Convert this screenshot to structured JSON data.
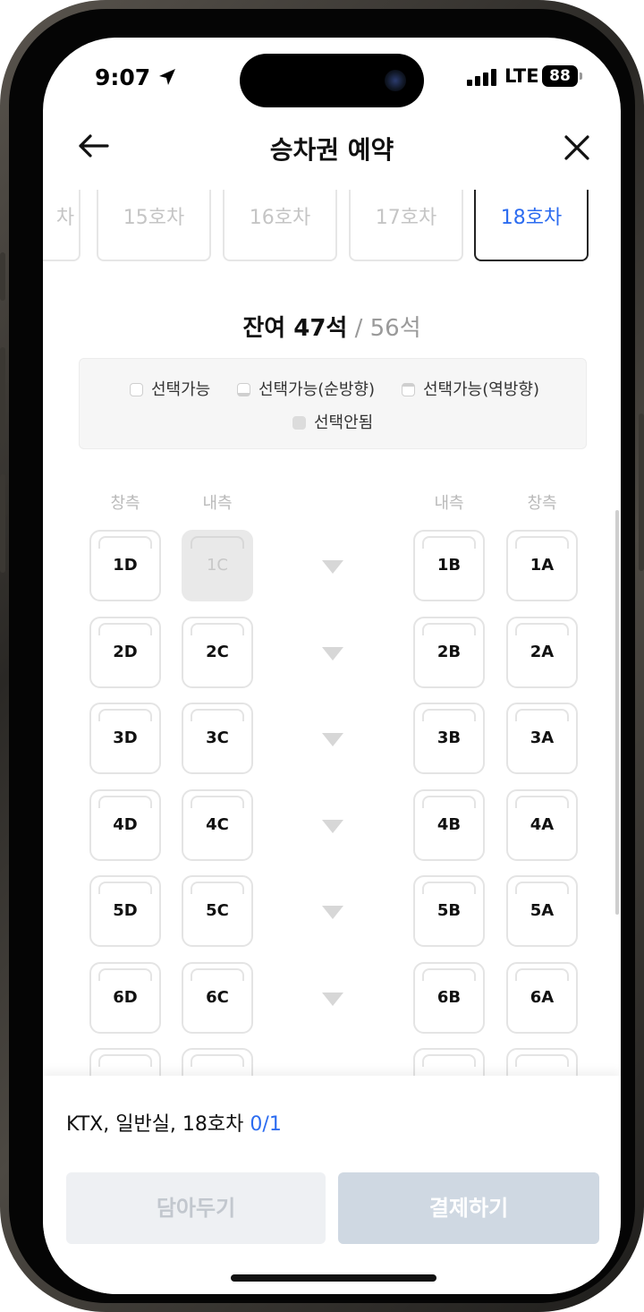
{
  "status": {
    "time": "9:07",
    "network": "LTE",
    "battery": "88",
    "location_icon": "location-arrow-icon",
    "signal_icon": "cellular-signal-icon"
  },
  "header": {
    "title": "승차권 예약",
    "back_icon": "arrow-left-icon",
    "close_icon": "close-icon"
  },
  "car_tabs": [
    {
      "label": "차",
      "active": false
    },
    {
      "label": "15호차",
      "active": false
    },
    {
      "label": "16호차",
      "active": false
    },
    {
      "label": "17호차",
      "active": false
    },
    {
      "label": "18호차",
      "active": true
    }
  ],
  "seat_summary": {
    "remaining": "잔여 47석",
    "separator": " / ",
    "total": "56석"
  },
  "legend": {
    "available": "선택가능",
    "forward": "선택가능(순방향)",
    "reverse": "선택가능(역방향)",
    "unavailable": "선택안됨"
  },
  "columns": {
    "window_left": "창측",
    "aisle_left": "내측",
    "aisle_right": "내측",
    "window_right": "창측"
  },
  "seats": [
    {
      "row": 1,
      "d": "1D",
      "c": "1C",
      "c_available": false,
      "b": "1B",
      "a": "1A"
    },
    {
      "row": 2,
      "d": "2D",
      "c": "2C",
      "c_available": true,
      "b": "2B",
      "a": "2A"
    },
    {
      "row": 3,
      "d": "3D",
      "c": "3C",
      "c_available": true,
      "b": "3B",
      "a": "3A"
    },
    {
      "row": 4,
      "d": "4D",
      "c": "4C",
      "c_available": true,
      "b": "4B",
      "a": "4A"
    },
    {
      "row": 5,
      "d": "5D",
      "c": "5C",
      "c_available": true,
      "b": "5B",
      "a": "5A"
    },
    {
      "row": 6,
      "d": "6D",
      "c": "6C",
      "c_available": true,
      "b": "6B",
      "a": "6A"
    }
  ],
  "footer": {
    "selection_info": "KTX, 일반실, 18호차",
    "selection_count": "0/1",
    "save_button": "담아두기",
    "pay_button": "결제하기"
  },
  "colors": {
    "accent": "#2c6cf0",
    "disabled_button": "#cfd8e2",
    "seat_unavailable": "#e9e9e9"
  }
}
